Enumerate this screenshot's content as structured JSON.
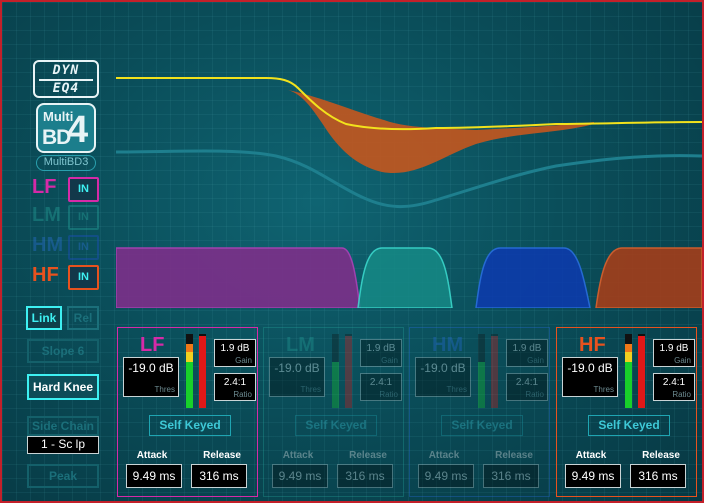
{
  "logos": {
    "dyneq_line1": "DYN",
    "dyneq_line2": "EQ4",
    "multibd4_line1": "Multi",
    "multibd4_line2": "BD",
    "multibd4_line3": "4",
    "multibd3": "MultiBD3"
  },
  "band_toggles": [
    {
      "label": "LF",
      "in_label": "IN",
      "active": true,
      "color": "#d62aa8"
    },
    {
      "label": "LM",
      "in_label": "IN",
      "active": false,
      "color": "#27a89e"
    },
    {
      "label": "HM",
      "in_label": "IN",
      "active": false,
      "color": "#1e4fbf"
    },
    {
      "label": "HF",
      "in_label": "IN",
      "active": true,
      "color": "#e8521e"
    }
  ],
  "controls": {
    "link": "Link",
    "rel": "Rel",
    "slope": "Slope 6",
    "hard_knee": "Hard Knee",
    "side_chain": "Side Chain",
    "side_chain_value": "1 - Sc lp",
    "peak": "Peak"
  },
  "modules": [
    {
      "name": "LF",
      "threshold": "-19.0 dB",
      "threshold_label": "Thres",
      "gain": "1.9 dB",
      "gain_label": "Gain",
      "ratio": "2.4:1",
      "ratio_label": "Ratio",
      "self_keyed": "Self Keyed",
      "attack_label": "Attack",
      "attack": "9.49 ms",
      "release_label": "Release",
      "release": "316 ms",
      "color": "#d62aa8",
      "active": true
    },
    {
      "name": "LM",
      "threshold": "-19.0 dB",
      "threshold_label": "Thres",
      "gain": "1.9 dB",
      "gain_label": "Gain",
      "ratio": "2.4:1",
      "ratio_label": "Ratio",
      "self_keyed": "Self Keyed",
      "attack_label": "Attack",
      "attack": "9.49 ms",
      "release_label": "Release",
      "release": "316 ms",
      "color": "#27a89e",
      "active": false
    },
    {
      "name": "HM",
      "threshold": "-19.0 dB",
      "threshold_label": "Thres",
      "gain": "1.9 dB",
      "gain_label": "Gain",
      "ratio": "2.4:1",
      "ratio_label": "Ratio",
      "self_keyed": "Self Keyed",
      "attack_label": "Attack",
      "attack": "9.49 ms",
      "release_label": "Release",
      "release": "316 ms",
      "color": "#1e4fbf",
      "active": false
    },
    {
      "name": "HF",
      "threshold": "-19.0 dB",
      "threshold_label": "Thres",
      "gain": "1.9 dB",
      "gain_label": "Gain",
      "ratio": "2.4:1",
      "ratio_label": "Ratio",
      "self_keyed": "Self Keyed",
      "attack_label": "Attack",
      "attack": "9.49 ms",
      "release_label": "Release",
      "release": "316 ms",
      "color": "#e8521e",
      "active": true
    }
  ],
  "colors": {
    "curve": "#f2e21c",
    "dynamic_fill": "#c4561e",
    "border": "#c3202a"
  }
}
